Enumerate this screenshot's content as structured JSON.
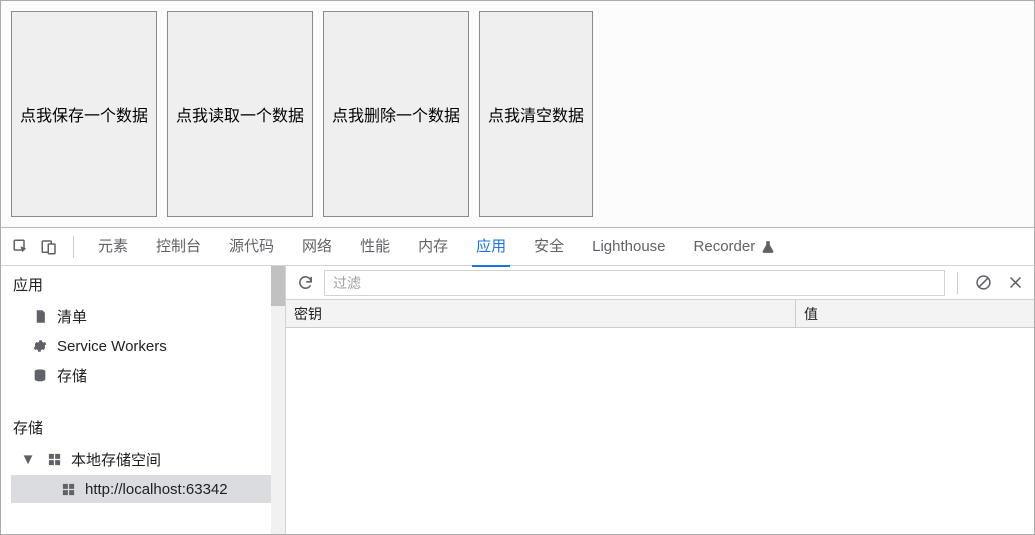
{
  "page": {
    "buttons": [
      "点我保存一个数据",
      "点我读取一个数据",
      "点我删除一个数据",
      "点我清空数据"
    ]
  },
  "devtools": {
    "tabs": {
      "elements": "元素",
      "console": "控制台",
      "sources": "源代码",
      "network": "网络",
      "performance": "性能",
      "memory": "内存",
      "application": "应用",
      "security": "安全",
      "lighthouse": "Lighthouse",
      "recorder": "Recorder"
    },
    "active_tab": "application",
    "sidebar": {
      "section_app": "应用",
      "items_app": {
        "manifest": "清单",
        "service_workers": "Service Workers",
        "storage": "存储"
      },
      "section_storage": "存储",
      "local_storage": "本地存储空间",
      "origin": "http://localhost:63342"
    },
    "toolbar": {
      "filter_placeholder": "过滤"
    },
    "table": {
      "key_header": "密钥",
      "value_header": "值",
      "rows": []
    }
  }
}
